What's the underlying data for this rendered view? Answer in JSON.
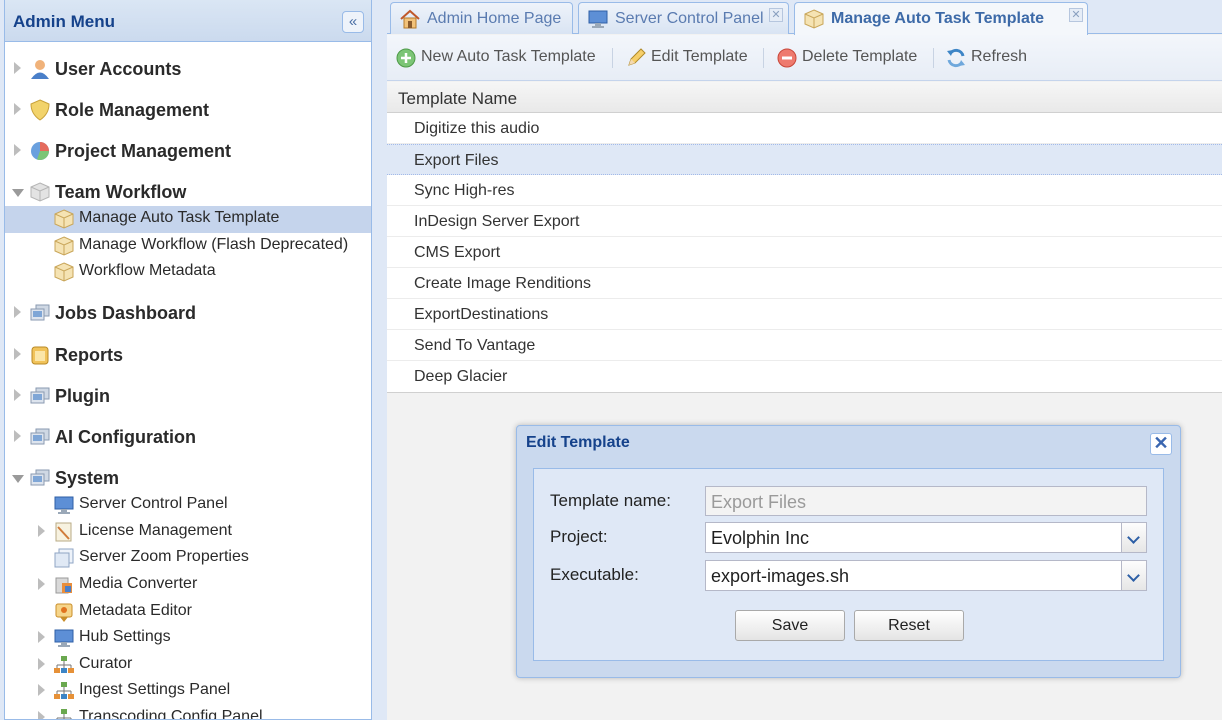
{
  "sidebar": {
    "title": "Admin Menu",
    "collapse_glyph": "«",
    "items": [
      {
        "label": "User Accounts",
        "icon": "user-icon"
      },
      {
        "label": "Role Management",
        "icon": "shield-icon"
      },
      {
        "label": "Project Management",
        "icon": "pie-chart-icon"
      },
      {
        "label": "Team Workflow",
        "icon": "cube-icon"
      },
      {
        "label": "Manage Auto Task Template",
        "icon": "box-icon"
      },
      {
        "label": "Manage Workflow (Flash Deprecated)",
        "icon": "box-icon"
      },
      {
        "label": "Workflow Metadata",
        "icon": "box-icon"
      },
      {
        "label": "Jobs Dashboard",
        "icon": "computer-icon"
      },
      {
        "label": "Reports",
        "icon": "reports-icon"
      },
      {
        "label": "Plugin",
        "icon": "computer-icon"
      },
      {
        "label": "AI Configuration",
        "icon": "computer-icon"
      },
      {
        "label": "System",
        "icon": "computer-icon"
      },
      {
        "label": "Server Control Panel",
        "icon": "monitor-icon"
      },
      {
        "label": "License Management",
        "icon": "license-icon"
      },
      {
        "label": "Server Zoom Properties",
        "icon": "properties-icon"
      },
      {
        "label": "Media Converter",
        "icon": "media-converter-icon"
      },
      {
        "label": "Metadata Editor",
        "icon": "metadata-icon"
      },
      {
        "label": "Hub Settings",
        "icon": "monitor-icon"
      },
      {
        "label": "Curator",
        "icon": "network-icon"
      },
      {
        "label": "Ingest Settings Panel",
        "icon": "network-icon"
      },
      {
        "label": "Transcoding Config Panel",
        "icon": "network-icon"
      }
    ]
  },
  "tabs": [
    {
      "label": "Admin Home Page",
      "icon": "home-icon"
    },
    {
      "label": "Server Control Panel",
      "icon": "monitor-icon"
    },
    {
      "label": "Manage Auto Task Template",
      "icon": "box-icon"
    }
  ],
  "tab_close_glyph": "✕",
  "toolbar": {
    "new_label": "New Auto Task Template",
    "edit_label": "Edit Template",
    "delete_label": "Delete Template",
    "refresh_label": "Refresh"
  },
  "grid": {
    "header": "Template Name",
    "rows": [
      "Digitize this audio",
      "Export Files",
      "Sync High-res",
      "InDesign Server Export",
      "CMS Export",
      "Create Image Renditions",
      "ExportDestinations",
      "Send To Vantage",
      "Deep Glacier"
    ]
  },
  "dialog": {
    "title": "Edit Template",
    "close_glyph": "✕",
    "template_name_label": "Template name:",
    "template_name_value": "Export Files",
    "project_label": "Project:",
    "project_value": "Evolphin Inc",
    "executable_label": "Executable:",
    "executable_value": "export-images.sh",
    "save_label": "Save",
    "reset_label": "Reset"
  },
  "colors": {
    "accent": "#15428b",
    "panel_border": "#99bbe8",
    "selection": "#c5d4ec"
  }
}
